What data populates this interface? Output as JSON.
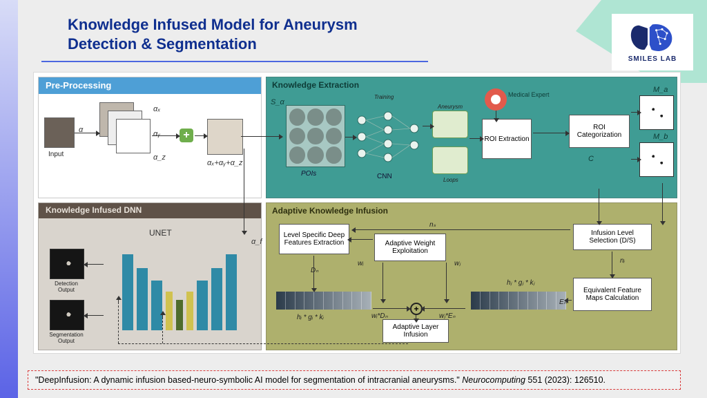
{
  "title": "Knowledge Infused Model for Aneurysm Detection & Segmentation",
  "logo": {
    "text": "SMILES  LAB"
  },
  "figure": {
    "preprocessing": {
      "header": "Pre-Processing",
      "input_label": "Input",
      "alpha": "α",
      "alpha_x": "αₓ",
      "alpha_y": "αᵧ",
      "alpha_z": "α_z",
      "alpha_sum": "αₓ+αᵧ+α_z"
    },
    "knowledge_extraction": {
      "header": "Knowledge Extraction",
      "s_alpha": "S_α",
      "pois": "POIs",
      "cnn": "CNN",
      "training": "Training",
      "aneurysm": "Aneurysm",
      "loops": "Loops",
      "expert": "Medical Expert",
      "roi_extraction": "ROI Extraction",
      "roi_categorization": "ROI Categorization",
      "c": "C",
      "m_a": "M_a",
      "m_b": "M_b"
    },
    "ki_dnn": {
      "header": "Knowledge Infused DNN",
      "unet": "UNET",
      "alpha_f": "α_f",
      "detection_output": "Detection Output",
      "segmentation_output": "Segmentation Output"
    },
    "adaptive": {
      "header": "Adaptive Knowledge Infusion",
      "level_extraction": "Level Specific Deep Features Extraction",
      "adaptive_weight": "Adaptive Weight Exploitation",
      "adaptive_layer": "Adaptive Layer Infusion",
      "infusion_selection": "Infusion Level Selection (D/S)",
      "equiv_maps": "Equivalent Feature Maps Calculation",
      "n_s": "nₛ",
      "n_i": "nᵢ",
      "w_i": "wᵢ",
      "w_j": "wⱼ",
      "D_n": "Dₙ",
      "E_n": "Eₙ",
      "h_g_k_left": "hᵢ * gᵢ * kᵢ",
      "h_g_k_right": "hⱼ * gⱼ * kⱼ",
      "wD": "wᵢ*Dₙ",
      "wE": "wⱼ*Eₙ"
    }
  },
  "citation": {
    "quote": "\"DeepInfusion: A dynamic infusion based-neuro-symbolic AI model for segmentation of intracranial aneurysms.\" ",
    "journal": "Neurocomputing",
    "rest": " 551 (2023): 126510."
  }
}
